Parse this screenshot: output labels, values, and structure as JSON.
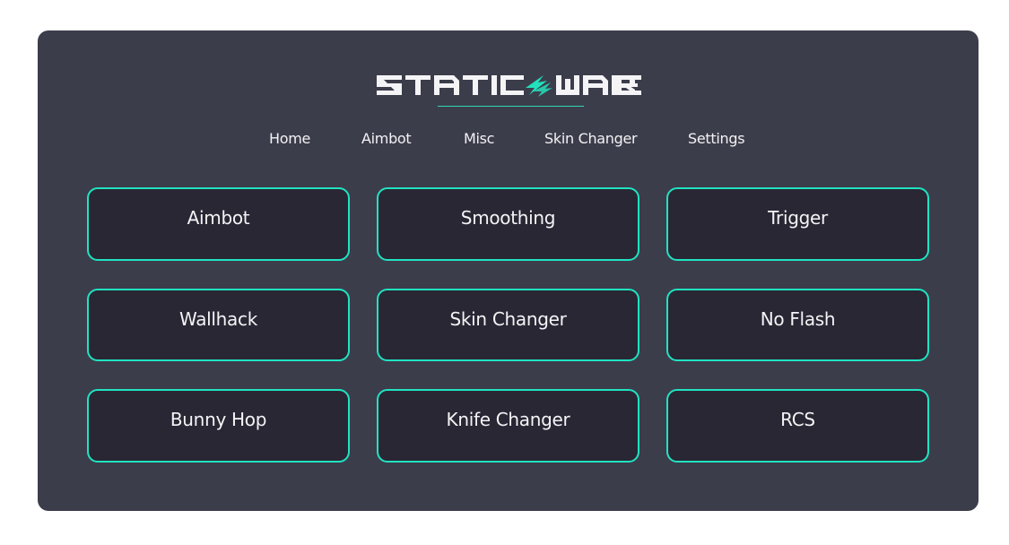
{
  "app": {
    "title": "STATIC WARE",
    "title_left": "STATIC",
    "title_right": "WARE",
    "logo_icon": "lightning-bolt-icon",
    "accent_color": "#20e3c2",
    "panel_color": "#3c3d4b",
    "button_color": "#292734"
  },
  "nav": {
    "items": [
      {
        "label": "Home"
      },
      {
        "label": "Aimbot"
      },
      {
        "label": "Misc"
      },
      {
        "label": "Skin Changer"
      },
      {
        "label": "Settings"
      }
    ]
  },
  "features": {
    "buttons": [
      {
        "label": "Aimbot"
      },
      {
        "label": "Smoothing"
      },
      {
        "label": "Trigger"
      },
      {
        "label": "Wallhack"
      },
      {
        "label": "Skin Changer"
      },
      {
        "label": "No Flash"
      },
      {
        "label": "Bunny Hop"
      },
      {
        "label": "Knife Changer"
      },
      {
        "label": "RCS"
      }
    ]
  }
}
